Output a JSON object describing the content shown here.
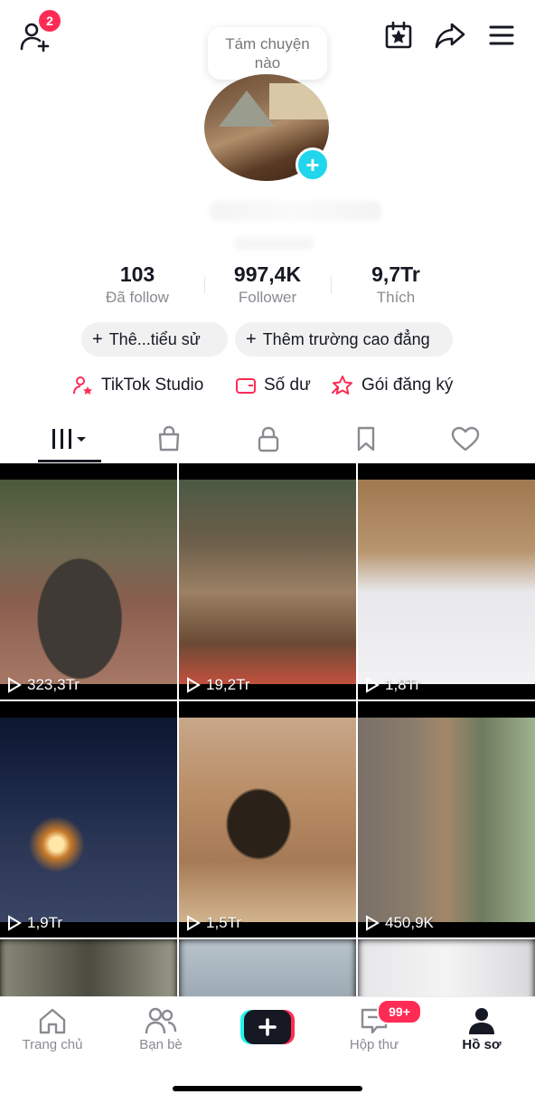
{
  "header": {
    "friends_badge": "2",
    "bubble_text": "Tám chuyện\nnào"
  },
  "stats": [
    {
      "value": "103",
      "label": "Đã follow"
    },
    {
      "value": "997,4K",
      "label": "Follower"
    },
    {
      "value": "9,7Tr",
      "label": "Thích"
    }
  ],
  "actions": {
    "bio_label": "Thê...tiểu sử",
    "school_label": "Thêm trường cao đẳng"
  },
  "tools": {
    "studio": "TikTok Studio",
    "balance": "Số dư",
    "subscription": "Gói đăng ký"
  },
  "videos": [
    {
      "views": "323,3Tr"
    },
    {
      "views": "19,2Tr"
    },
    {
      "views": "1,8Tr"
    },
    {
      "views": "1,9Tr"
    },
    {
      "views": "1,5Tr"
    },
    {
      "views": "450,9K"
    }
  ],
  "nav": {
    "home": "Trang chủ",
    "friends": "Bạn bè",
    "inbox": "Hộp thư",
    "inbox_badge": "99+",
    "profile": "Hồ sơ"
  },
  "colors": {
    "accent": "#fe2c55",
    "avatar_plus": "#20d5ec",
    "text": "#161823",
    "muted": "#8a8b91"
  }
}
